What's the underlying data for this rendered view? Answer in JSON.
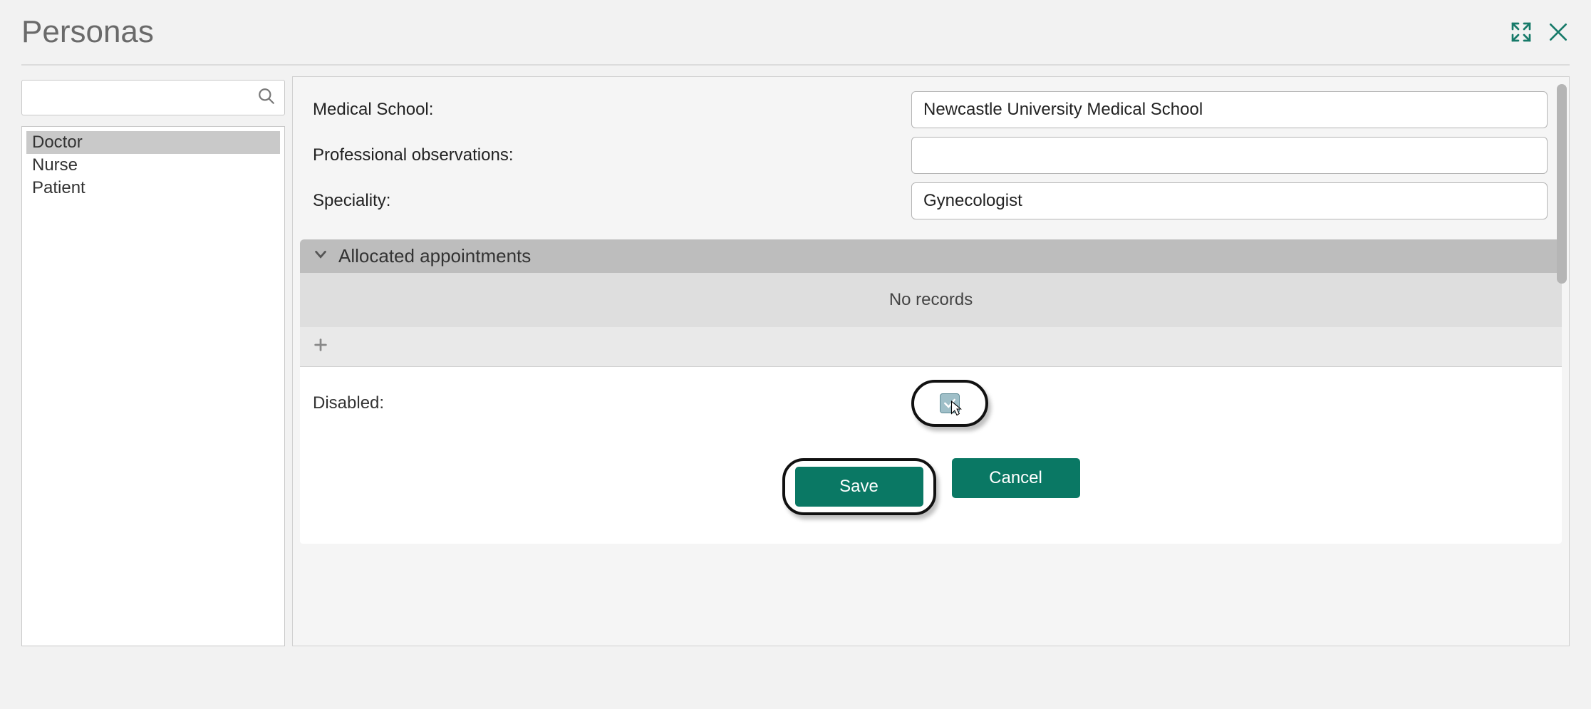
{
  "header": {
    "title": "Personas"
  },
  "sidebar": {
    "search_placeholder": "",
    "items": [
      {
        "label": "Doctor",
        "selected": true
      },
      {
        "label": "Nurse",
        "selected": false
      },
      {
        "label": "Patient",
        "selected": false
      }
    ]
  },
  "form": {
    "fields": {
      "medical_school": {
        "label": "Medical School:",
        "value": "Newcastle University Medical School"
      },
      "professional_observations": {
        "label": "Professional observations:",
        "value": ""
      },
      "speciality": {
        "label": "Speciality:",
        "value": "Gynecologist"
      }
    },
    "section": {
      "title": "Allocated appointments",
      "empty_text": "No records"
    },
    "disabled": {
      "label": "Disabled:",
      "checked": true
    },
    "buttons": {
      "save": "Save",
      "cancel": "Cancel"
    }
  },
  "colors": {
    "primary": "#0a7864",
    "accent_icon": "#177a69"
  }
}
